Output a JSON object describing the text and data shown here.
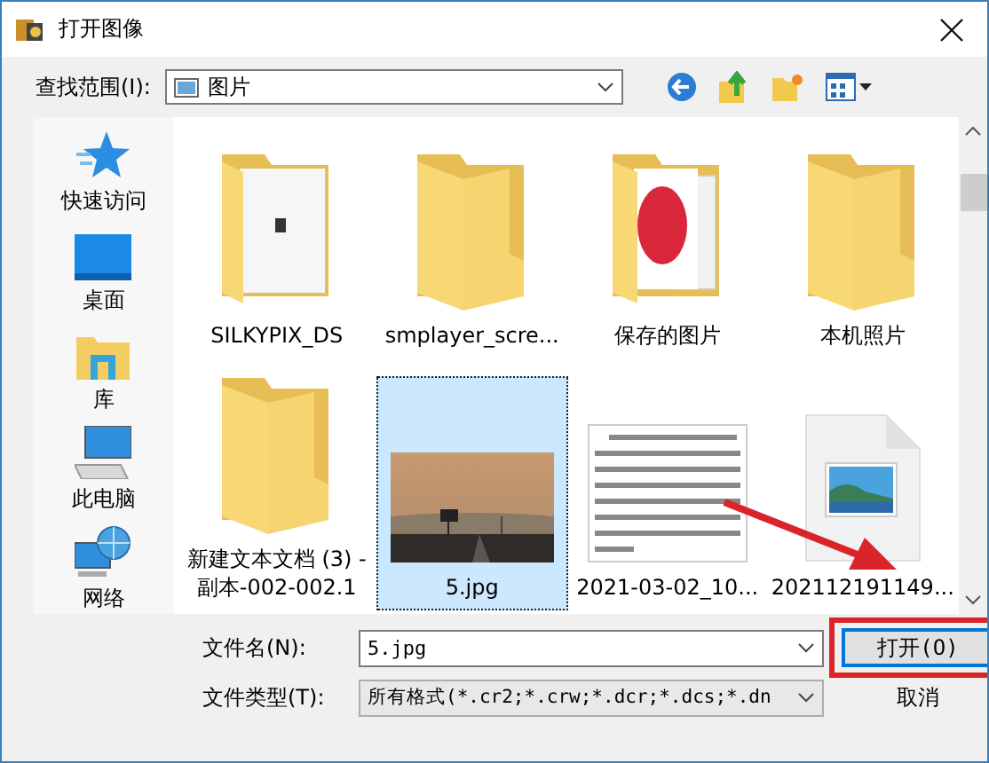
{
  "window": {
    "title": "打开图像"
  },
  "look_in": {
    "label": "查找范围(I):",
    "value": "图片"
  },
  "sidebar": {
    "items": [
      {
        "label": "快速访问",
        "kind": "star"
      },
      {
        "label": "桌面",
        "kind": "desktop"
      },
      {
        "label": "库",
        "kind": "library"
      },
      {
        "label": "此电脑",
        "kind": "computer"
      },
      {
        "label": "网络",
        "kind": "network"
      }
    ]
  },
  "files": [
    {
      "name": "SILKYPIX_DS",
      "kind": "folder-doc",
      "selected": false
    },
    {
      "name": "smplayer_scre...",
      "kind": "folder",
      "selected": false
    },
    {
      "name": "保存的图片",
      "kind": "folder-photo",
      "selected": false
    },
    {
      "name": "本机照片",
      "kind": "folder",
      "selected": false
    },
    {
      "name": "新建文本文档 (3) - 副本-002-002.1",
      "kind": "folder",
      "selected": false
    },
    {
      "name": "5.jpg",
      "selected": true
    },
    {
      "name": "2021-03-02_10...",
      "kind": "document",
      "selected": false
    },
    {
      "name": "202112191149...",
      "kind": "image-file",
      "selected": false
    }
  ],
  "file_name": {
    "label": "文件名(N):",
    "value": "5.jpg"
  },
  "file_type": {
    "label": "文件类型(T):",
    "value": "所有格式(*.cr2;*.crw;*.dcr;*.dcs;*.dn"
  },
  "buttons": [
    {
      "label": "打开(O)",
      "highlighted": true
    },
    {
      "label": "取消"
    }
  ]
}
